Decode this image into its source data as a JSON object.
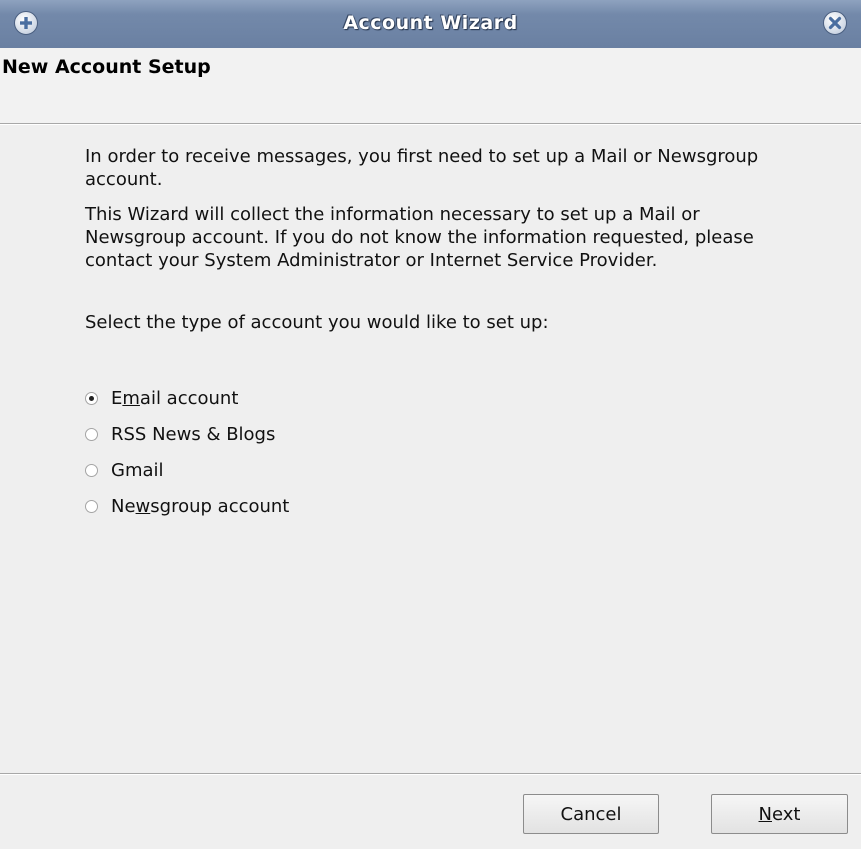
{
  "window": {
    "title": "Account Wizard"
  },
  "header": {
    "heading": "New Account Setup"
  },
  "intro": {
    "paragraph1": "In order to receive messages, you first need to set up a Mail or Newsgroup account.",
    "paragraph2": "This Wizard will collect the information necessary to set up a Mail or Newsgroup account. If you do not know the information requested, please contact your System Administrator or Internet Service Provider.",
    "prompt": "Select the type of account you would like to set up:"
  },
  "account_types": {
    "options": [
      {
        "pre": "E",
        "accel": "m",
        "post": "ail account",
        "checked": true
      },
      {
        "pre": "RSS News & Blogs",
        "accel": "",
        "post": "",
        "checked": false
      },
      {
        "pre": "Gmail",
        "accel": "",
        "post": "",
        "checked": false
      },
      {
        "pre": "Ne",
        "accel": "w",
        "post": "sgroup account",
        "checked": false
      }
    ],
    "selected": "Email account"
  },
  "footer": {
    "cancel_label": "Cancel",
    "next_accel": "N",
    "next_rest": "ext"
  },
  "colors": {
    "titlebar": "#7389aa",
    "background": "#efefef",
    "icon_blue": "#4a6ea0"
  },
  "icons": {
    "titlebar_left": "plus-icon",
    "titlebar_right": "close-icon"
  }
}
